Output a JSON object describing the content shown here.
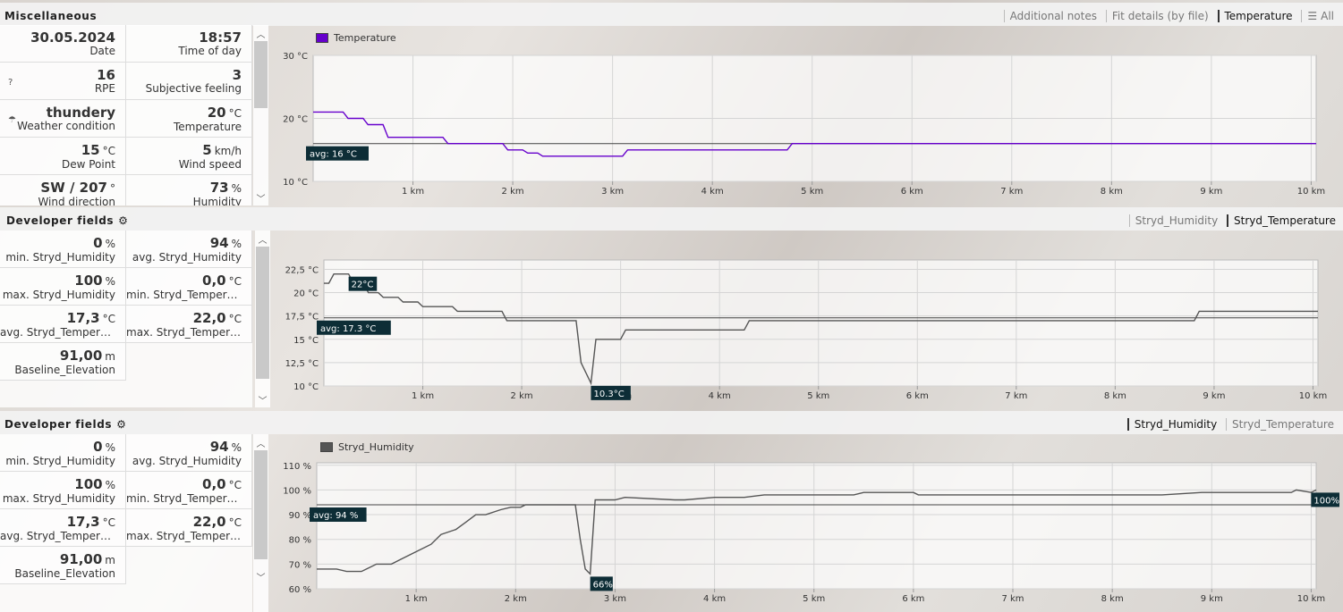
{
  "bg": {
    "accent_temp": "#6600cc",
    "line_gray": "#555555",
    "tag_bg": "#0d2d36"
  },
  "misc": {
    "title": "Miscellaneous",
    "tabs": [
      {
        "label": "Additional notes",
        "active": false
      },
      {
        "label": "Fit details (by file)",
        "active": false
      },
      {
        "label": "Temperature",
        "active": true
      },
      {
        "label": "All",
        "active": false,
        "icon": "hamburger-icon"
      }
    ],
    "cells": [
      {
        "value": "30.05.2024",
        "unit": "",
        "label": "Date"
      },
      {
        "value": "18:57",
        "unit": "",
        "label": "Time of day"
      },
      {
        "value": "16",
        "unit": "",
        "label": "RPE",
        "icon": "help-icon"
      },
      {
        "value": "3",
        "unit": "",
        "label": "Subjective feeling"
      },
      {
        "value": "thundery",
        "unit": "",
        "label": "Weather condition",
        "icon": "weather-thunder-icon"
      },
      {
        "value": "20",
        "unit": "°C",
        "label": "Temperature"
      },
      {
        "value": "15",
        "unit": "°C",
        "label": "Dew Point"
      },
      {
        "value": "5",
        "unit": "km/h",
        "label": "Wind speed"
      },
      {
        "value": "SW / 207",
        "unit": "°",
        "label": "Wind direction"
      },
      {
        "value": "73",
        "unit": "%",
        "label": "Humidity"
      }
    ]
  },
  "dev1": {
    "title": "Developer fields",
    "tabs": [
      {
        "label": "Stryd_Humidity",
        "active": false
      },
      {
        "label": "Stryd_Temperature",
        "active": true
      }
    ],
    "cells": [
      {
        "value": "0",
        "unit": "%",
        "label": "min. Stryd_Humidity"
      },
      {
        "value": "94",
        "unit": "%",
        "label": "avg. Stryd_Humidity"
      },
      {
        "value": "100",
        "unit": "%",
        "label": "max. Stryd_Humidity"
      },
      {
        "value": "0,0",
        "unit": "°C",
        "label": "min. Stryd_Temperature"
      },
      {
        "value": "17,3",
        "unit": "°C",
        "label": "avg. Stryd_Temperature"
      },
      {
        "value": "22,0",
        "unit": "°C",
        "label": "max. Stryd_Temperature"
      },
      {
        "value": "91,00",
        "unit": "m",
        "label": "Baseline_Elevation"
      }
    ]
  },
  "dev2": {
    "title": "Developer fields",
    "tabs": [
      {
        "label": "Stryd_Humidity",
        "active": true
      },
      {
        "label": "Stryd_Temperature",
        "active": false
      }
    ],
    "cells": [
      {
        "value": "0",
        "unit": "%",
        "label": "min. Stryd_Humidity"
      },
      {
        "value": "94",
        "unit": "%",
        "label": "avg. Stryd_Humidity"
      },
      {
        "value": "100",
        "unit": "%",
        "label": "max. Stryd_Humidity"
      },
      {
        "value": "0,0",
        "unit": "°C",
        "label": "min. Stryd_Temperature"
      },
      {
        "value": "17,3",
        "unit": "°C",
        "label": "avg. Stryd_Temperature"
      },
      {
        "value": "22,0",
        "unit": "°C",
        "label": "max. Stryd_Temperature"
      },
      {
        "value": "91,00",
        "unit": "m",
        "label": "Baseline_Elevation"
      }
    ]
  },
  "chart_data": [
    {
      "type": "line",
      "legend": "Temperature",
      "color": "#6600cc",
      "xlim": [
        0,
        10.05
      ],
      "ylim": [
        10,
        30
      ],
      "yticks": [
        10,
        20,
        30
      ],
      "ytick_labels": [
        "10 °C",
        "20 °C",
        "30 °C"
      ],
      "xticks": [
        1,
        2,
        3,
        4,
        5,
        6,
        7,
        8,
        9,
        10
      ],
      "xtick_labels": [
        "1 km",
        "2 km",
        "3 km",
        "4 km",
        "5 km",
        "6 km",
        "7 km",
        "8 km",
        "9 km",
        "10 km"
      ],
      "avg": 16,
      "avg_label": "avg: 16 °C",
      "x": [
        0,
        0.3,
        0.35,
        0.5,
        0.55,
        0.7,
        0.75,
        1.3,
        1.35,
        1.9,
        1.95,
        2.1,
        2.15,
        2.25,
        2.3,
        3.1,
        3.15,
        4.75,
        4.8,
        10.05
      ],
      "y": [
        21,
        21,
        20,
        20,
        19,
        19,
        17,
        17,
        16,
        16,
        15,
        15,
        14.5,
        14.5,
        14,
        14,
        15,
        15,
        16,
        16
      ],
      "callouts": []
    },
    {
      "type": "line",
      "legend": "",
      "color": "#555555",
      "xlim": [
        0,
        10.05
      ],
      "ylim": [
        10,
        23.5
      ],
      "yticks": [
        10,
        12.5,
        15,
        17.5,
        20,
        22.5
      ],
      "ytick_labels": [
        "10 °C",
        "12,5 °C",
        "15 °C",
        "17,5 °C",
        "20 °C",
        "22,5 °C"
      ],
      "xticks": [
        1,
        2,
        3,
        4,
        5,
        6,
        7,
        8,
        9,
        10
      ],
      "xtick_labels": [
        "1 km",
        "2 km",
        "3 km",
        "4 km",
        "5 km",
        "6 km",
        "7 km",
        "8 km",
        "9 km",
        "10 km"
      ],
      "avg": 17.3,
      "avg_label": "avg: 17.3 °C",
      "x": [
        0,
        0.05,
        0.1,
        0.25,
        0.3,
        0.4,
        0.45,
        0.55,
        0.6,
        0.75,
        0.8,
        0.95,
        1.0,
        1.3,
        1.35,
        1.8,
        1.85,
        2.55,
        2.6,
        2.7,
        2.75,
        3.0,
        3.05,
        4.25,
        4.3,
        8.8,
        8.85,
        10.05
      ],
      "y": [
        21,
        21,
        22,
        22,
        21,
        21,
        20,
        20,
        19.5,
        19.5,
        19,
        19,
        18.5,
        18.5,
        18,
        18,
        17,
        17,
        12.5,
        10.3,
        15,
        15,
        16,
        16,
        17,
        17,
        18,
        18
      ],
      "callouts": [
        {
          "x": 0.25,
          "y": 22,
          "label": "22°C",
          "place": "below"
        },
        {
          "x": 2.7,
          "y": 10.3,
          "label": "10.3°C",
          "place": "below"
        }
      ]
    },
    {
      "type": "line",
      "legend": "Stryd_Humidity",
      "color": "#555555",
      "xlim": [
        0,
        10.05
      ],
      "ylim": [
        60,
        111
      ],
      "yticks": [
        60,
        70,
        80,
        90,
        100,
        110
      ],
      "ytick_labels": [
        "60 %",
        "70 %",
        "80 %",
        "90 %",
        "100 %",
        "110 %"
      ],
      "xticks": [
        1,
        2,
        3,
        4,
        5,
        6,
        7,
        8,
        9,
        10
      ],
      "xtick_labels": [
        "1 km",
        "2 km",
        "3 km",
        "4 km",
        "5 km",
        "6 km",
        "7 km",
        "8 km",
        "9 km",
        "10 km"
      ],
      "avg": 94,
      "avg_label": "avg: 94 %",
      "x": [
        0,
        0.2,
        0.3,
        0.45,
        0.5,
        0.6,
        0.75,
        0.85,
        1.0,
        1.15,
        1.25,
        1.4,
        1.5,
        1.6,
        1.7,
        1.85,
        1.95,
        2.05,
        2.1,
        2.6,
        2.65,
        2.7,
        2.75,
        2.8,
        3.0,
        3.1,
        3.6,
        3.7,
        4.0,
        4.3,
        4.5,
        4.8,
        5.4,
        5.5,
        6.0,
        6.05,
        7.0,
        7.5,
        8.0,
        8.5,
        8.9,
        9.5,
        9.8,
        9.85,
        10.0,
        10.05
      ],
      "y": [
        68,
        68,
        67,
        67,
        68,
        70,
        70,
        72,
        75,
        78,
        82,
        84,
        87,
        90,
        90,
        92,
        93,
        93,
        94,
        94,
        80,
        68,
        66,
        96,
        96,
        97,
        96,
        96,
        97,
        97,
        98,
        98,
        98,
        99,
        99,
        98,
        98,
        98,
        98,
        98,
        99,
        99,
        99,
        100,
        99,
        100
      ],
      "callouts": [
        {
          "x": 2.75,
          "y": 66,
          "label": "66%",
          "place": "below"
        },
        {
          "x": 10.05,
          "y": 100,
          "label": "100%",
          "place": "below-left"
        }
      ]
    }
  ]
}
